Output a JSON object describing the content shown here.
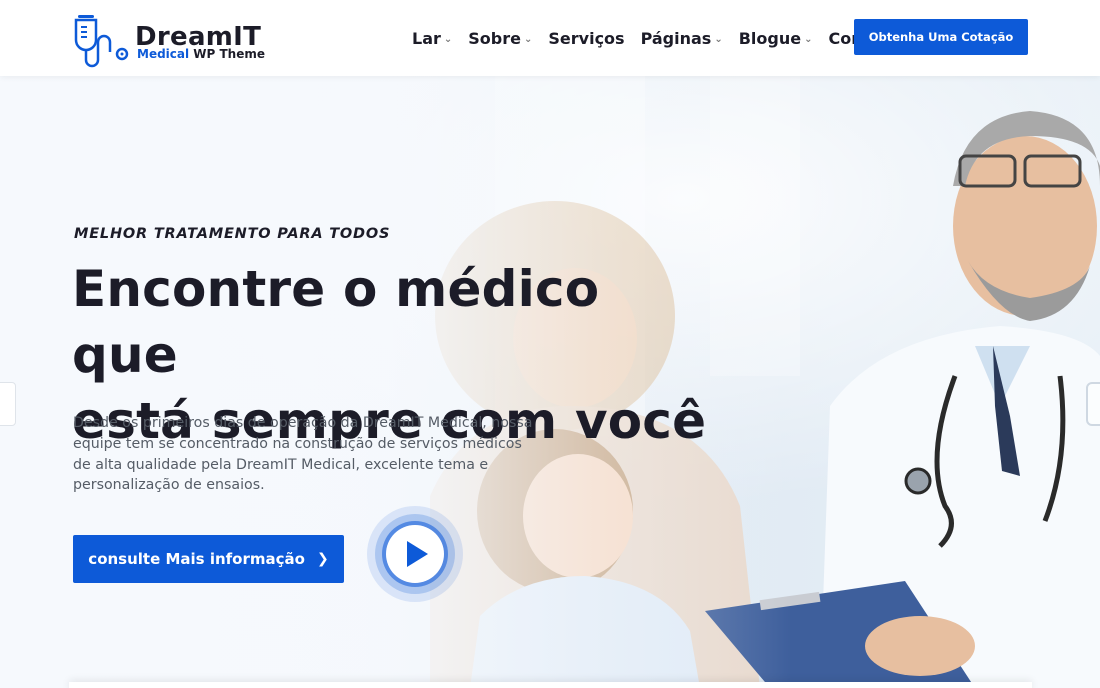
{
  "brand": {
    "title": "DreamIT",
    "sub_accent": "Medical",
    "sub_rest": " WP Theme",
    "accent_color": "#0d5ad8"
  },
  "nav": {
    "items": [
      {
        "label": "Lar",
        "has_dropdown": true
      },
      {
        "label": "Sobre",
        "has_dropdown": true
      },
      {
        "label": "Serviços",
        "has_dropdown": false
      },
      {
        "label": "Páginas",
        "has_dropdown": true
      },
      {
        "label": "Blogue",
        "has_dropdown": true
      },
      {
        "label": "Contato",
        "has_dropdown": false
      }
    ],
    "quote_button": "Obtenha Uma Cotação"
  },
  "hero": {
    "eyebrow": "MELHOR TRATAMENTO PARA TODOS",
    "headline_line1": "Encontre o médico que",
    "headline_line2": "está sempre com você",
    "description": "Desde os primeiros dias de operação da DreamIT Medical, nossa equipe tem se concentrado na construção de serviços médicos de alta qualidade pela DreamIT Medical, excelente tema e personalização de ensaios.",
    "cta_label": "consulte Mais informação",
    "cta_icon": "chevron-right-icon",
    "play_icon": "play-icon"
  }
}
